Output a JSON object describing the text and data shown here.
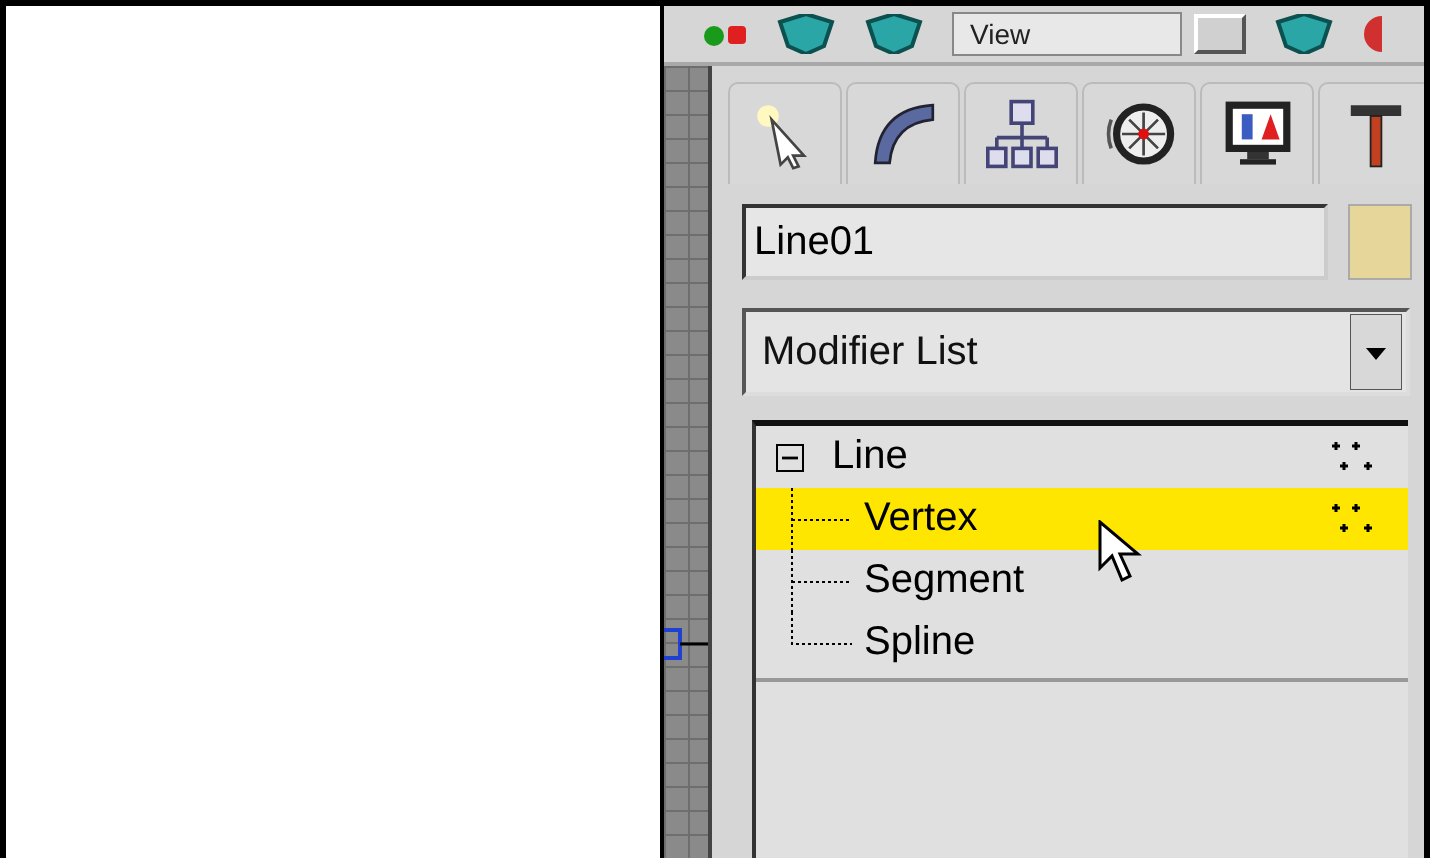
{
  "toolbar": {
    "view_dropdown": "View"
  },
  "command_tabs": [
    {
      "kind": "create"
    },
    {
      "kind": "modify"
    },
    {
      "kind": "hierarchy"
    },
    {
      "kind": "motion"
    },
    {
      "kind": "display"
    },
    {
      "kind": "utilities"
    }
  ],
  "object_name": {
    "value": "Line01"
  },
  "modifier_list": {
    "value": "Modifier List"
  },
  "modifier_stack": [
    {
      "label": "Line",
      "expanded": true,
      "selected": false,
      "children": [
        {
          "label": "Vertex",
          "selected": true
        },
        {
          "label": "Segment",
          "selected": false
        },
        {
          "label": "Spline",
          "selected": false
        }
      ]
    }
  ]
}
